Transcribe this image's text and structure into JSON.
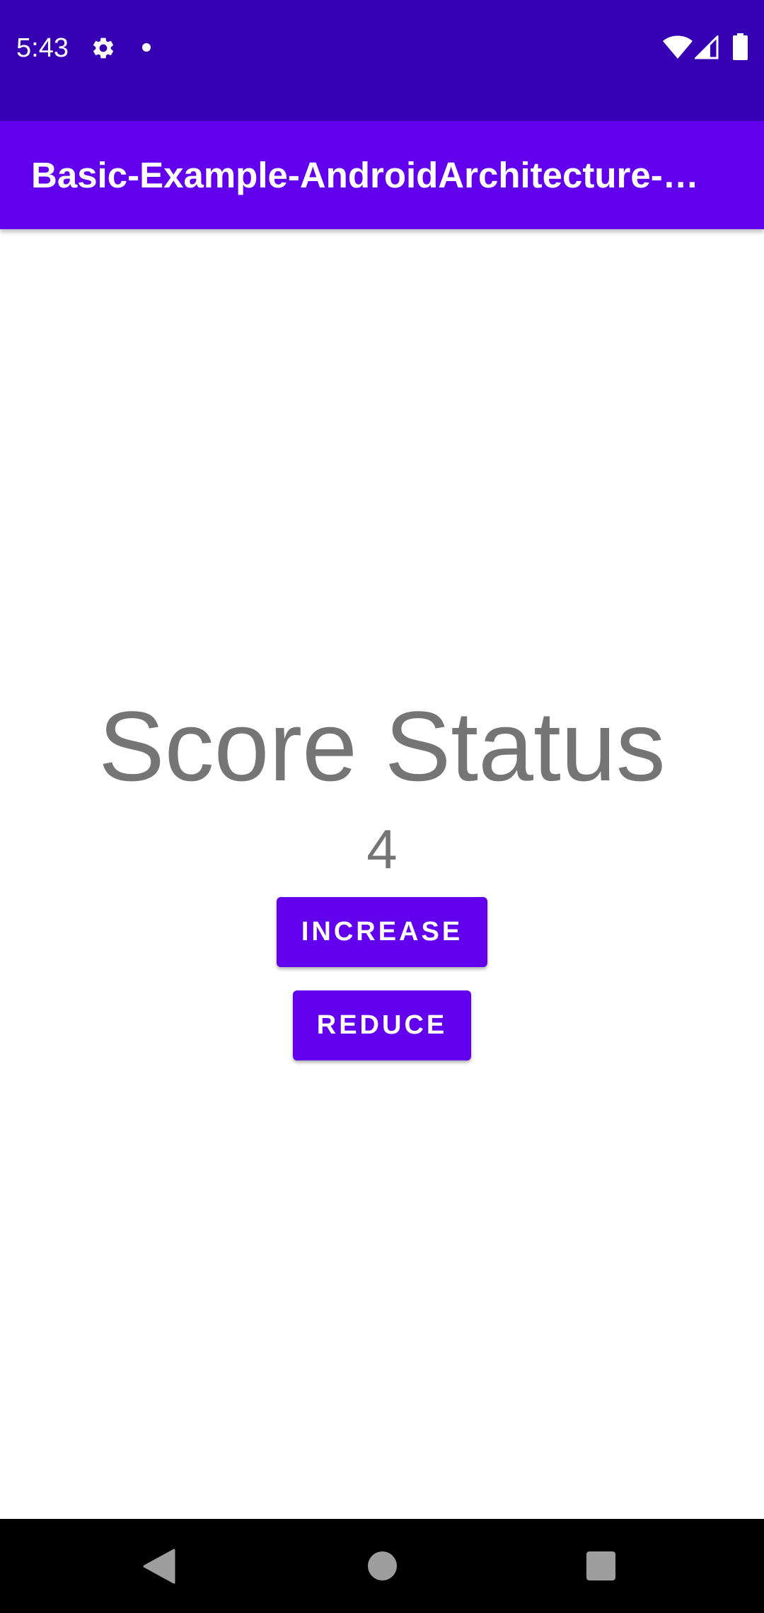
{
  "status_bar": {
    "time": "5:43",
    "icons": [
      "gear-icon",
      "notification-dot-icon",
      "wifi-icon",
      "signal-icon",
      "battery-icon"
    ]
  },
  "app_bar": {
    "title": "Basic-Example-AndroidArchitecture-…",
    "color": "#6200ee"
  },
  "main": {
    "score_title": "Score Status",
    "score_value": "4",
    "increase_label": "INCREASE",
    "reduce_label": "REDUCE"
  },
  "nav_bar": {
    "icons": [
      "back-icon",
      "home-icon",
      "recents-icon"
    ]
  },
  "colors": {
    "status_bar": "#3700b3",
    "primary": "#6200ee",
    "text_secondary": "#757575"
  }
}
